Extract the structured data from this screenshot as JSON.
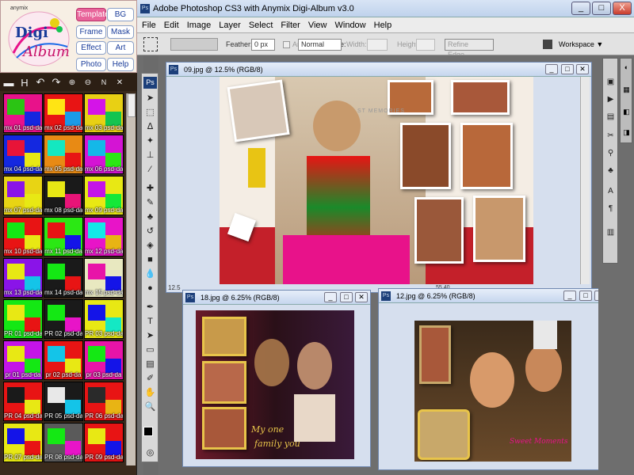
{
  "app": {
    "title": "Adobe Photoshop CS3 with Anymix Digi-Album v3.0",
    "ps_badge": "Ps",
    "win_buttons": [
      "_",
      "□",
      "X"
    ]
  },
  "left_panel": {
    "brand": "anymix",
    "logo_line1": "Digi",
    "logo_line2": "Album",
    "buttons": [
      {
        "label": "Template",
        "active": true
      },
      {
        "label": "BG"
      },
      {
        "label": "Frame"
      },
      {
        "label": "Mask"
      },
      {
        "label": "Effect"
      },
      {
        "label": "Art"
      },
      {
        "label": "Photo"
      },
      {
        "label": "Help"
      }
    ],
    "toolbar_icons": [
      "folder-icon",
      "save-icon",
      "undo-icon",
      "redo-icon",
      "zoom-in-icon",
      "zoom-out-icon",
      "fit-icon",
      "close-icon"
    ],
    "thumbnails": [
      {
        "label": "mx 01 psd-da",
        "colors": [
          "#e8128a",
          "#2bc414",
          "#1526e0"
        ]
      },
      {
        "label": "mx 02 psd-da",
        "colors": [
          "#e81414",
          "#ffe414",
          "#1a9ae8"
        ]
      },
      {
        "label": "mx 03 psd-da",
        "colors": [
          "#e8d014",
          "#d414e8",
          "#14c450"
        ]
      },
      {
        "label": "mx 04 psd-da",
        "colors": [
          "#1428e0",
          "#e81438",
          "#e8e814"
        ]
      },
      {
        "label": "mx 05 psd-da",
        "colors": [
          "#e88a14",
          "#14e8c0",
          "#e81414"
        ]
      },
      {
        "label": "mx 06 psd-da",
        "colors": [
          "#d414d4",
          "#14b8e8",
          "#2be814"
        ]
      },
      {
        "label": "mx 07 psd-da",
        "colors": [
          "#e8d414",
          "#8a14e8",
          "#e8e814"
        ]
      },
      {
        "label": "mx 08 psd-da",
        "colors": [
          "#1a1a1a",
          "#e8e814",
          "#e81478"
        ]
      },
      {
        "label": "mx 09 psd-da",
        "colors": [
          "#e8e814",
          "#c414e8",
          "#14e838"
        ]
      },
      {
        "label": "mx 10 psd-da",
        "colors": [
          "#e81414",
          "#14e814",
          "#e8e814"
        ]
      },
      {
        "label": "mx 11 psd-da",
        "colors": [
          "#2be814",
          "#e81414",
          "#1414e8"
        ]
      },
      {
        "label": "mx 12 psd-da",
        "colors": [
          "#e814c8",
          "#14e8e8",
          "#e8b414"
        ]
      },
      {
        "label": "mx 13 psd-da",
        "colors": [
          "#8a14e8",
          "#e8e814",
          "#14c4e8"
        ]
      },
      {
        "label": "mx 14 psd-da",
        "colors": [
          "#1a1a1a",
          "#14e814",
          "#e81414"
        ]
      },
      {
        "label": "mx 15 psd-da",
        "colors": [
          "#e8e8c0",
          "#e814a8",
          "#1414e8"
        ]
      },
      {
        "label": "PR 01 psd-da",
        "colors": [
          "#14e814",
          "#e8e814",
          "#e81414"
        ]
      },
      {
        "label": "PR 02 psd-da",
        "colors": [
          "#1a1a1a",
          "#14e814",
          "#e814c8"
        ]
      },
      {
        "label": "PR 03 psd-da",
        "colors": [
          "#e8e814",
          "#1414e8",
          "#14e8c4"
        ]
      },
      {
        "label": "pr 01 psd-da",
        "colors": [
          "#c414e8",
          "#e8e814",
          "#14e814"
        ]
      },
      {
        "label": "pr 02 psd-da",
        "colors": [
          "#e81414",
          "#14c4e8",
          "#e8e814"
        ]
      },
      {
        "label": "pr 03 psd-da",
        "colors": [
          "#e814a8",
          "#14e814",
          "#1414e8"
        ]
      },
      {
        "label": "PR 04 psd-da",
        "colors": [
          "#e81414",
          "#1a1a1a",
          "#e8e814"
        ]
      },
      {
        "label": "PR 05 psd-da",
        "colors": [
          "#1a1a1a",
          "#e8e8e8",
          "#14c4e8"
        ]
      },
      {
        "label": "PR 06 psd-da",
        "colors": [
          "#e81414",
          "#2a2a2a",
          "#e8b414"
        ]
      },
      {
        "label": "PR 07 psd-da",
        "colors": [
          "#e8e814",
          "#1414e8",
          "#e81414"
        ]
      },
      {
        "label": "PR 08 psd-da",
        "colors": [
          "#5a5a5a",
          "#14e814",
          "#e814c8"
        ]
      },
      {
        "label": "PR 09 psd-da",
        "colors": [
          "#e81414",
          "#e8e814",
          "#1414e8"
        ]
      }
    ]
  },
  "menu": [
    "File",
    "Edit",
    "Image",
    "Layer",
    "Select",
    "Filter",
    "View",
    "Window",
    "Help"
  ],
  "options_bar": {
    "feather_label": "Feather:",
    "feather_value": "0 px",
    "antialias_label": "Anti-alias",
    "style_label": "Style:",
    "style_value": "Normal",
    "width_label": "Width:",
    "height_label": "Height:",
    "refine_edge": "Refine Edge...",
    "workspace": "Workspace ▼"
  },
  "documents": [
    {
      "title": "09.jpg @ 12.5% (RGB/8)",
      "zoom_label": "12.5",
      "status": "55.40"
    },
    {
      "title": "18.jpg @ 6.25% (RGB/8)"
    },
    {
      "title": "12.jpg @ 6.25% (RGB/8)"
    }
  ],
  "doc09_text": "ST MEMORIES",
  "doc18_text_line1": "My one",
  "doc18_text_line2": "family you",
  "doc12_text": "Sweet Moments",
  "colors": {
    "accent_pink": "#e8649a",
    "ps_blue": "#1c3f7a",
    "panel_brown": "#3a2a1c"
  }
}
